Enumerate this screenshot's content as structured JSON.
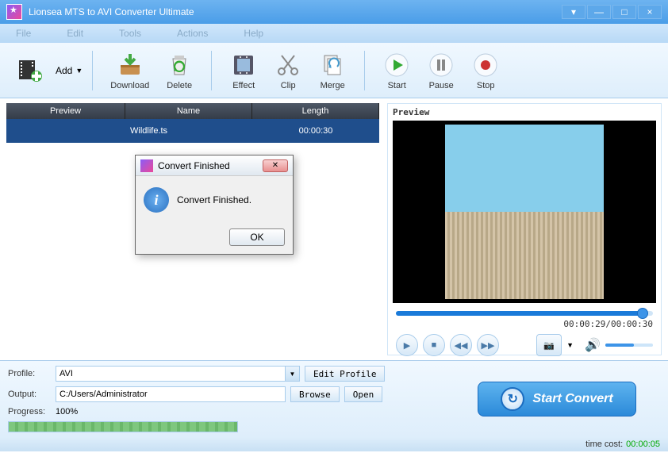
{
  "window": {
    "title": "Lionsea MTS to AVI Converter Ultimate"
  },
  "menu": {
    "file": "File",
    "edit": "Edit",
    "tools": "Tools",
    "actions": "Actions",
    "help": "Help"
  },
  "toolbar": {
    "add": "Add",
    "download": "Download",
    "delete": "Delete",
    "effect": "Effect",
    "clip": "Clip",
    "merge": "Merge",
    "start": "Start",
    "pause": "Pause",
    "stop": "Stop"
  },
  "table": {
    "headers": {
      "preview": "Preview",
      "name": "Name",
      "length": "Length"
    },
    "rows": [
      {
        "name": "Wildlife.ts",
        "length": "00:00:30"
      }
    ]
  },
  "preview": {
    "label": "Preview",
    "time": "00:00:29/00:00:30"
  },
  "settings": {
    "profile_label": "Profile:",
    "profile_value": "AVI",
    "edit_profile": "Edit Profile",
    "output_label": "Output:",
    "output_value": "C:/Users/Administrator",
    "browse": "Browse",
    "open": "Open",
    "progress_label": "Progress:",
    "progress_value": "100%"
  },
  "convert": {
    "label": "Start Convert"
  },
  "status": {
    "label": "time cost:",
    "value": "00:00:05"
  },
  "dialog": {
    "title": "Convert Finished",
    "message": "Convert Finished.",
    "ok": "OK"
  }
}
